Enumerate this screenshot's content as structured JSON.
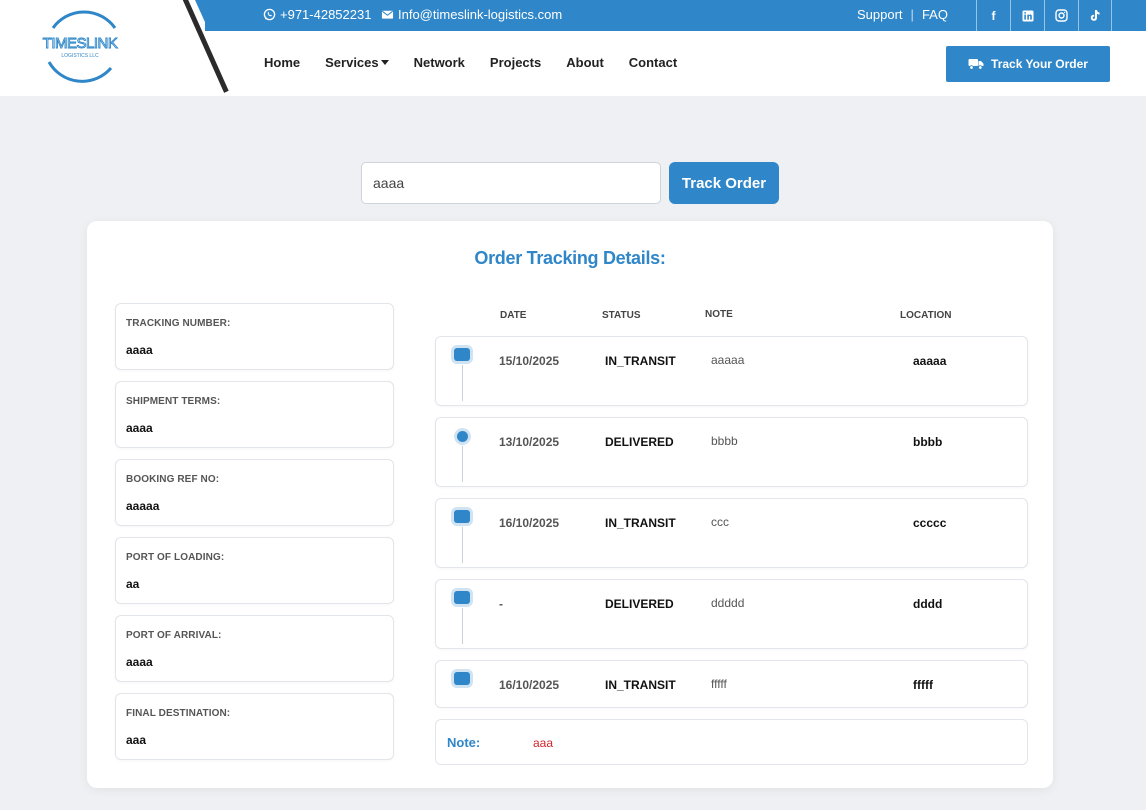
{
  "header": {
    "phone": "+971-42852231",
    "email": "Info@timeslink-logistics.com",
    "support_label": "Support",
    "faq_label": "FAQ",
    "socials": [
      "f",
      "in",
      "ig",
      "tt"
    ],
    "logo_text": "TIMESLINK",
    "logo_subtext": "LOGISTICS LLC",
    "nav": [
      {
        "label": "Home"
      },
      {
        "label": "Services"
      },
      {
        "label": "Network"
      },
      {
        "label": "Projects"
      },
      {
        "label": "About"
      },
      {
        "label": "Contact"
      }
    ],
    "track_your_order_label": "Track Your Order"
  },
  "search": {
    "value": "aaaa",
    "button_label": "Track Order"
  },
  "details": {
    "title": "Order Tracking Details:",
    "fields": [
      {
        "label": "TRACKING NUMBER:",
        "value": "aaaa"
      },
      {
        "label": "SHIPMENT TERMS:",
        "value": "aaaa"
      },
      {
        "label": "BOOKING REF NO:",
        "value": "aaaaa"
      },
      {
        "label": "PORT OF LOADING:",
        "value": "aa"
      },
      {
        "label": "PORT OF ARRIVAL:",
        "value": "aaaa"
      },
      {
        "label": "FINAL DESTINATION:",
        "value": "aaa"
      }
    ],
    "columns": {
      "date": "DATE",
      "status": "STATUS",
      "note": "NOTE",
      "location": "LOCATION"
    },
    "rows": [
      {
        "date": "15/10/2025",
        "status": "IN_TRANSIT",
        "note": "aaaaa",
        "location": "aaaaa"
      },
      {
        "date": "13/10/2025",
        "status": "DELIVERED",
        "note": "bbbb",
        "location": "bbbb"
      },
      {
        "date": "16/10/2025",
        "status": "IN_TRANSIT",
        "note": "ccc",
        "location": "ccccc"
      },
      {
        "date": "-",
        "status": "DELIVERED",
        "note": "ddddd",
        "location": "dddd"
      },
      {
        "date": "16/10/2025",
        "status": "IN_TRANSIT",
        "note": "fffff",
        "location": "fffff"
      }
    ],
    "note_label": "Note:",
    "note_value": "aaa"
  },
  "colors": {
    "accent": "#2f86c8",
    "note_value": "#d0262b"
  }
}
